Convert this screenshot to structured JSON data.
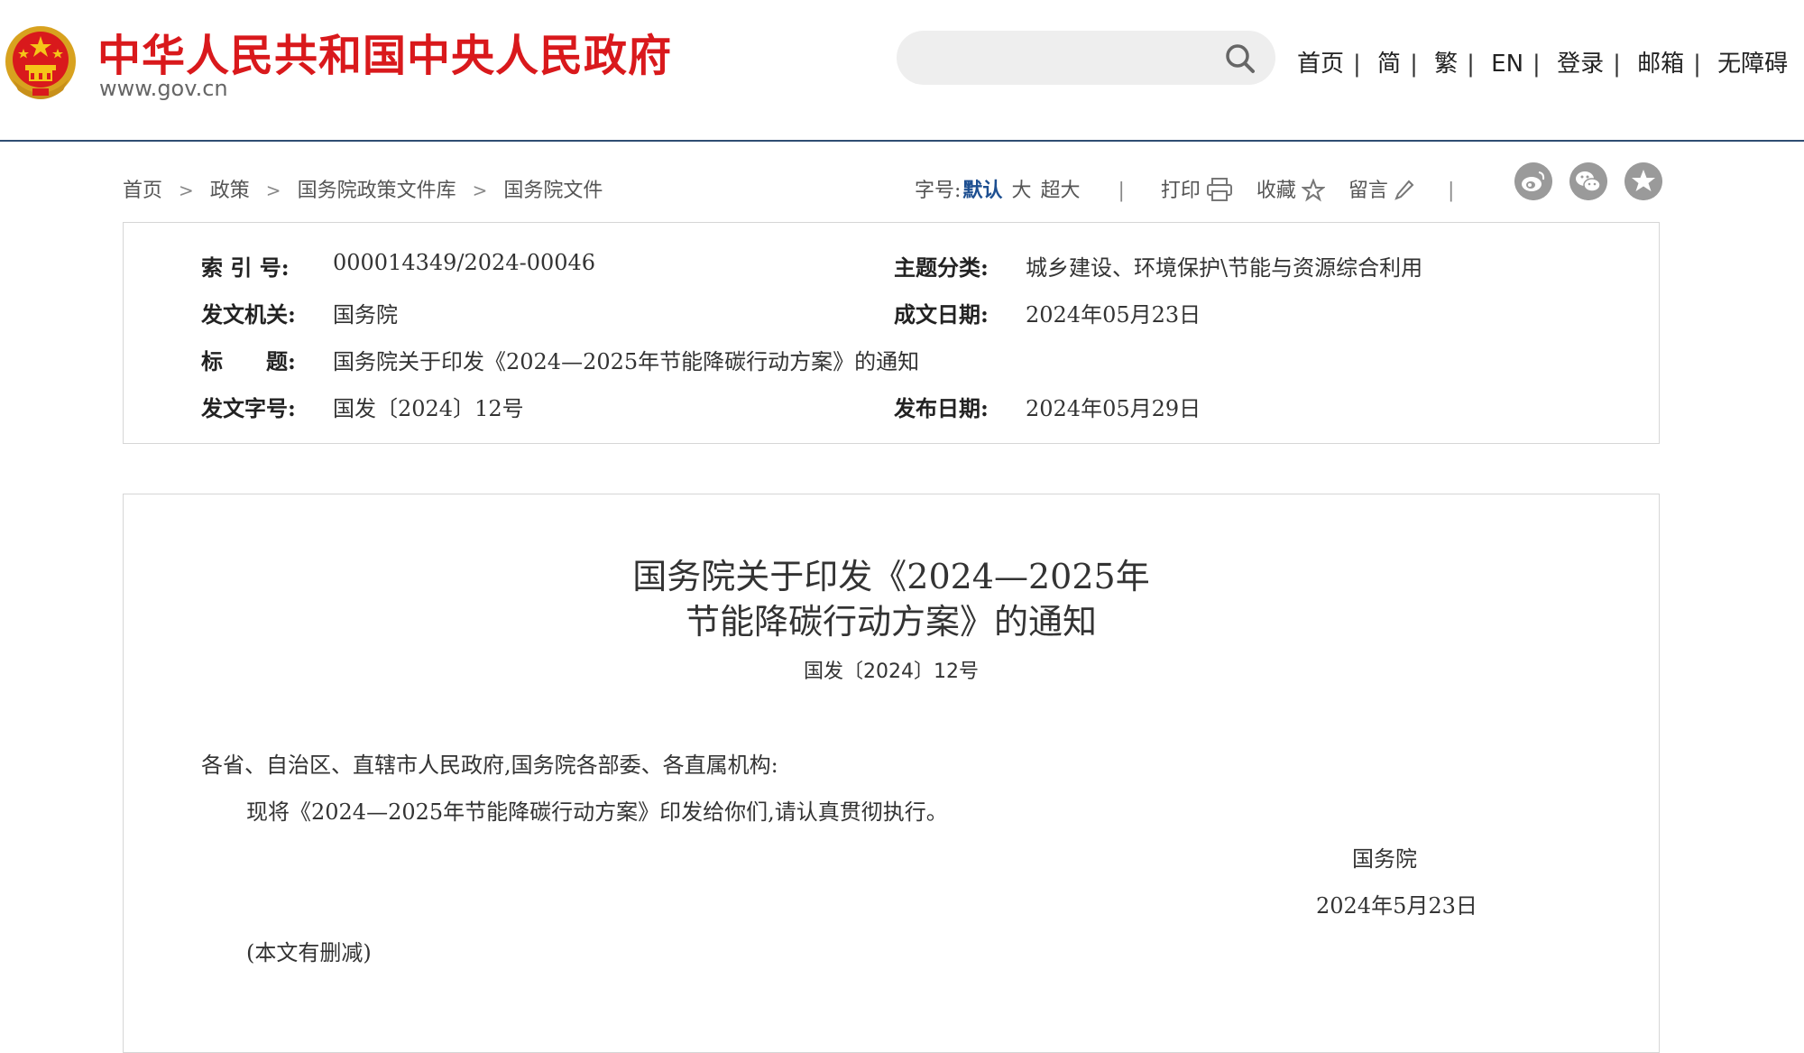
{
  "header": {
    "site_title": "中华人民共和国中央人民政府",
    "site_url": "www.gov.cn",
    "search": {
      "placeholder": ""
    },
    "nav": [
      "首页",
      "简",
      "繁",
      "EN",
      "登录",
      "邮箱",
      "无障碍"
    ],
    "colors": {
      "title_red": "#d9191c",
      "accent_blue": "#1d4f91"
    }
  },
  "breadcrumb": [
    "首页",
    "政策",
    "国务院政策文件库",
    "国务院文件"
  ],
  "toolbar": {
    "font_size_label": "字号:",
    "font_options": [
      "默认",
      "大",
      "超大"
    ],
    "active_font_option": "默认",
    "print_label": "打印",
    "favorite_label": "收藏",
    "comment_label": "留言",
    "share_icons": [
      "weibo-icon",
      "wechat-icon",
      "favorite-star-icon"
    ]
  },
  "info": {
    "index_label": "索 引 号:",
    "index_value": "000014349/2024-00046",
    "category_label": "主题分类:",
    "category_value": "城乡建设、环境保护\\节能与资源综合利用",
    "issuer_label": "发文机关:",
    "issuer_value": "国务院",
    "created_label": "成文日期:",
    "created_value": "2024年05月23日",
    "title_label": "标　　题:",
    "title_value": "国务院关于印发《2024—2025年节能降碳行动方案》的通知",
    "doc_no_label": "发文字号:",
    "doc_no_value": "国发〔2024〕12号",
    "published_label": "发布日期:",
    "published_value": "2024年05月29日"
  },
  "article": {
    "title_line1": "国务院关于印发《2024—2025年",
    "title_line2": "节能降碳行动方案》的通知",
    "doc_number": "国发〔2024〕12号",
    "salutation": "各省、自治区、直辖市人民政府,国务院各部委、各直属机构:",
    "body": "现将《2024—2025年节能降碳行动方案》印发给你们,请认真贯彻执行。",
    "signature": "国务院",
    "date": "2024年5月23日",
    "note": "(本文有删减)"
  }
}
